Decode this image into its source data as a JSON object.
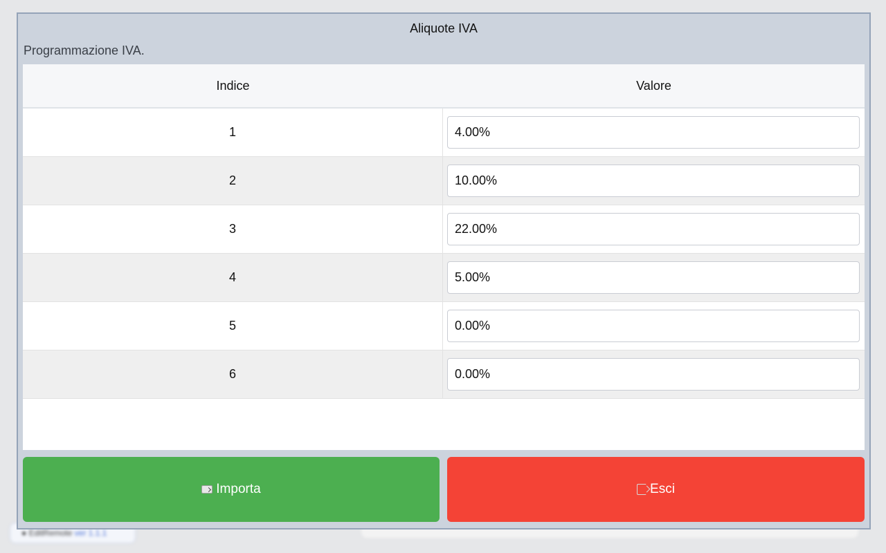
{
  "background": {
    "app_name": "EditRemote",
    "version": "ver 1.1.1"
  },
  "modal": {
    "title": "Aliquote IVA",
    "subtitle": "Programmazione IVA.",
    "table": {
      "headers": [
        "Indice",
        "Valore"
      ],
      "rows": [
        {
          "index": "1",
          "value": "4.00%"
        },
        {
          "index": "2",
          "value": "10.00%"
        },
        {
          "index": "3",
          "value": "22.00%"
        },
        {
          "index": "4",
          "value": "5.00%"
        },
        {
          "index": "5",
          "value": "0.00%"
        },
        {
          "index": "6",
          "value": "0.00%"
        }
      ]
    },
    "buttons": {
      "import": {
        "label": "Importa",
        "icon": "folder-import-icon",
        "color": "#4caf50"
      },
      "exit": {
        "label": "Esci",
        "icon": "exit-icon",
        "color": "#f44336"
      }
    }
  }
}
